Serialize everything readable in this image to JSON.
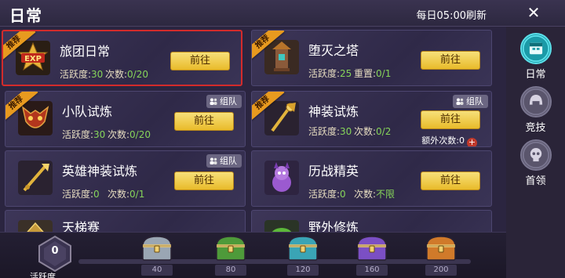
{
  "header": {
    "title": "日常",
    "refresh_text": "每日05:00刷新",
    "close_symbol": "✕"
  },
  "activities": [
    {
      "name": "旅团日常",
      "badge": "推荐",
      "icon": "exp-star-icon",
      "stat1_label": "活跃度:",
      "stat1_value": "30",
      "stat2_label": "次数:",
      "stat2_value": "0/20",
      "button": "前往",
      "selected": true
    },
    {
      "name": "堕灭之塔",
      "badge": "推荐",
      "icon": "tower-icon",
      "stat1_label": "活跃度:",
      "stat1_value": "25",
      "stat2_label": "重置:",
      "stat2_value": "0/1",
      "button": "前往"
    },
    {
      "name": "小队试炼",
      "badge": "推荐",
      "icon": "demon-mask-icon",
      "team": "组队",
      "stat1_label": "活跃度:",
      "stat1_value": "30",
      "stat2_label": "次数:",
      "stat2_value": "0/20",
      "button": "前往"
    },
    {
      "name": "神装试炼",
      "badge": "推荐",
      "icon": "golden-staff-icon",
      "team": "组队",
      "stat1_label": "活跃度:",
      "stat1_value": "30",
      "stat2_label": "次数:",
      "stat2_value": "0/2",
      "button": "前往",
      "extra_label": "额外次数:",
      "extra_value": "0"
    },
    {
      "name": "英雄神装试炼",
      "icon": "golden-spear-icon",
      "team": "组队",
      "stat1_label": "活跃度:",
      "stat1_value": "0",
      "stat2_label": "次数:",
      "stat2_value": "0/1",
      "button": "前往"
    },
    {
      "name": "历战精英",
      "icon": "purple-imp-icon",
      "stat1_label": "活跃度:",
      "stat1_value": "0",
      "stat2_label": "次数:",
      "stat2_value": "不限",
      "button": "前往"
    },
    {
      "name": "天梯赛",
      "icon": "ladder-icon"
    },
    {
      "name": "野外修炼",
      "icon": "green-creature-icon"
    }
  ],
  "sidebar": [
    {
      "label": "日常",
      "icon": "daily-calendar-icon",
      "active": true
    },
    {
      "label": "竞技",
      "icon": "arena-helmet-icon"
    },
    {
      "label": "首领",
      "icon": "boss-skull-icon"
    }
  ],
  "activity_bar": {
    "value": "0",
    "label": "活跃度",
    "progress": 0,
    "max": 200
  },
  "chests": [
    {
      "threshold": "40",
      "color": "#9aa6b3"
    },
    {
      "threshold": "80",
      "color": "#4e9a3a"
    },
    {
      "threshold": "120",
      "color": "#3aa4b5"
    },
    {
      "threshold": "160",
      "color": "#7b4fc4"
    },
    {
      "threshold": "200",
      "color": "#d07a2a"
    }
  ],
  "colors": {
    "accent_gold": "#e9bb2a",
    "ribbon_orange": "#e89a1f",
    "value_green": "#86d45a",
    "selected_red": "#d32b2b",
    "active_tab": "#1b9aa7"
  }
}
